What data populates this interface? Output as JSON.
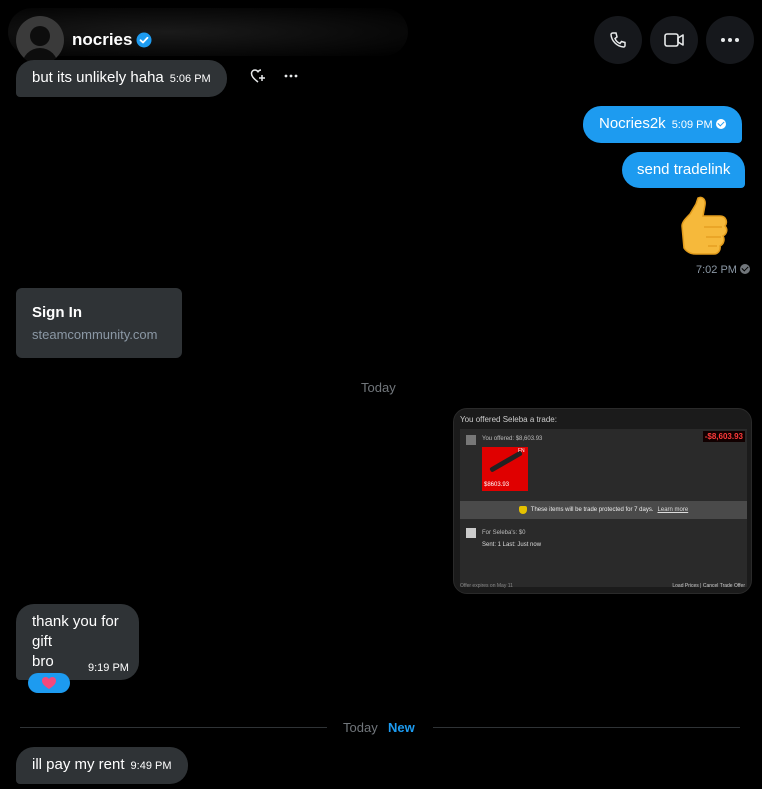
{
  "header": {
    "contact_name": "nocries"
  },
  "messages": [
    {
      "text": "but its unlikely haha",
      "time": "5:06 PM"
    },
    {
      "text": "Nocries2k",
      "time": "5:09 PM"
    },
    {
      "text": "send tradelink"
    },
    {
      "emoji": "thumbs-up",
      "time": "7:02 PM"
    }
  ],
  "link_card": {
    "title": "Sign In",
    "domain": "steamcommunity.com"
  },
  "day_separator": "Today",
  "trade_screenshot": {
    "title": "You offered Seleba a trade:",
    "offered": "You offered: $8,603.93",
    "total": "-$8,603.93",
    "item_tag": "FN",
    "item_value": "$8603.93",
    "protect_text": "These items will be trade protected for 7 days.",
    "learn_more": "Learn more",
    "for_text": "For Seleba's: $0",
    "sent_text": "Sent: 1 Last: Just now",
    "footer_left": "Offer expires on May 11",
    "footer_right": "Load Prices | Cancel Trade Offer"
  },
  "gift_message": {
    "lines": [
      "thank you for",
      "gift",
      "bro"
    ],
    "time": "9:19 PM",
    "reaction": "heart"
  },
  "new_separator": {
    "day": "Today",
    "label": "New"
  },
  "last_message": {
    "text": "ill pay my rent",
    "time": "9:49 PM"
  },
  "colors": {
    "accent": "#1d9bf0",
    "bubble_received": "#2f3336",
    "background": "#000000"
  }
}
